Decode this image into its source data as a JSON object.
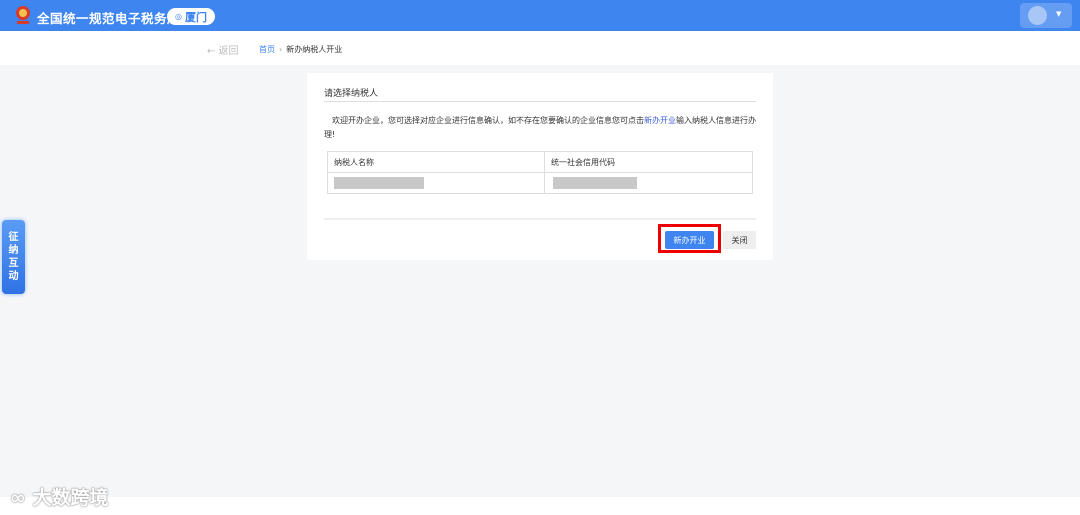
{
  "header": {
    "title": "全国统一规范电子税务局",
    "city": "厦门"
  },
  "breadcrumb": {
    "back": "← 返回",
    "home": "首页",
    "sep": "›",
    "current": "新办纳税人开业"
  },
  "card": {
    "title": "请选择纳税人",
    "message_pre": "欢迎开办企业，您可选择对应企业进行信息确认，如不存在您要确认的企业信息您可点击",
    "message_link": "新办开业",
    "message_post": "输入纳税人信息进行办理!",
    "table": {
      "headers": [
        "纳税人名称",
        "统一社会信用代码"
      ]
    },
    "buttons": {
      "new": "新办开业",
      "close": "关闭"
    }
  },
  "side_tab": [
    "征",
    "纳",
    "互",
    "动"
  ],
  "watermark": "大数跨境",
  "colors": {
    "brand": "#3e85ef",
    "highlight": "#e00000"
  }
}
